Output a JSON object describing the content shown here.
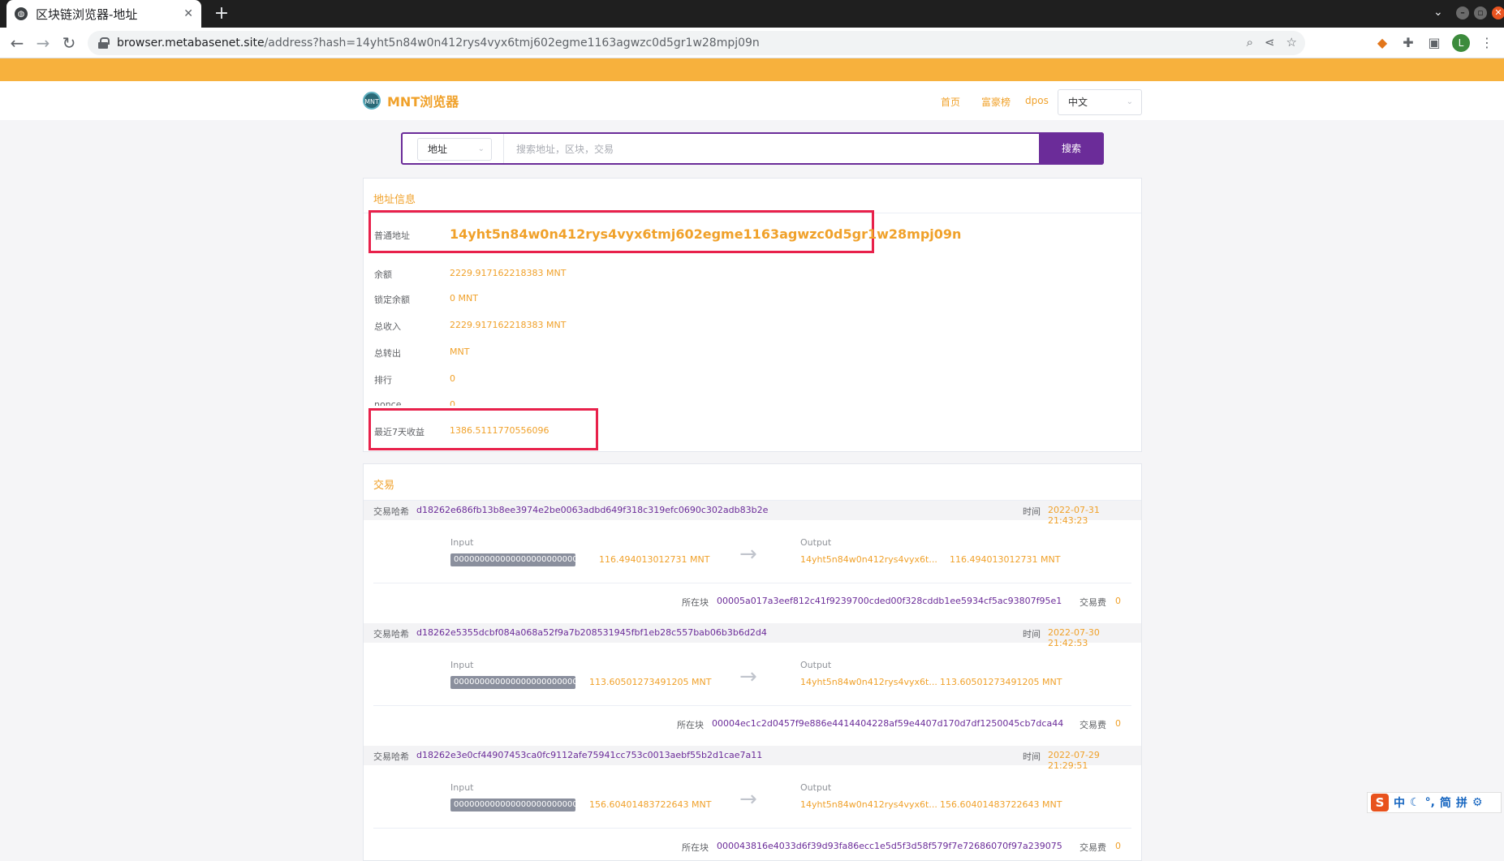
{
  "browser": {
    "tab_title": "区块链浏览器-地址",
    "url_host": "browser.metabasenet.site",
    "url_path": "/address?hash=14yht5n84w0n412rys4vyx6tmj602egme1163agwzc0d5gr1w28mpj09n",
    "avatar_letter": "L"
  },
  "header": {
    "logo_text": "MNT浏览器",
    "nav": [
      "首页",
      "富豪榜",
      "dpos"
    ],
    "language": "中文"
  },
  "search": {
    "type": "地址",
    "placeholder": "搜索地址，区块，交易",
    "button": "搜索"
  },
  "address_info": {
    "title": "地址信息",
    "rows": [
      {
        "label": "普通地址",
        "value": "14yht5n84w0n412rys4vyx6tmj602egme1163agwzc0d5gr1w28mpj09n"
      },
      {
        "label": "余额",
        "value": "2229.917162218383 MNT"
      },
      {
        "label": "锁定余额",
        "value": "0 MNT"
      },
      {
        "label": "总收入",
        "value": "2229.917162218383 MNT"
      },
      {
        "label": "总转出",
        "value": "MNT"
      },
      {
        "label": "排行",
        "value": "0"
      },
      {
        "label": "nonce",
        "value": "0"
      },
      {
        "label": "最近7天收益",
        "value": "1386.5111770556096"
      }
    ]
  },
  "transactions": {
    "title": "交易",
    "hash_label": "交易哈希",
    "time_label": "时间",
    "input_label": "Input",
    "output_label": "Output",
    "block_label": "所在块",
    "fee_label": "交易费",
    "items": [
      {
        "hash": "d18262e686fb13b8ee3974e2be0063adbd649f318c319efc0690c302adb83b2e",
        "time": "2022-07-31 21:43:23",
        "input_addr": "00000000000000000000000000000",
        "input_amount": "116.494013012731 MNT",
        "output_addr": "14yht5n84w0n412rys4vyx6t...",
        "output_amount": "116.494013012731 MNT",
        "block": "00005a017a3eef812c41f9239700cded00f328cddb1ee5934cf5ac93807f95e1",
        "fee": "0"
      },
      {
        "hash": "d18262e5355dcbf084a068a52f9a7b208531945fbf1eb28c557bab06b3b6d2d4",
        "time": "2022-07-30 21:42:53",
        "input_addr": "00000000000000000000000000000",
        "input_amount": "113.60501273491205 MNT",
        "output_addr": "14yht5n84w0n412rys4vyx6t...",
        "output_amount": "113.60501273491205 MNT",
        "block": "00004ec1c2d0457f9e886e4414404228af59e4407d170d7df1250045cb7dca44",
        "fee": "0"
      },
      {
        "hash": "d18262e3e0cf44907453ca0fc9112afe75941cc753c0013aebf55b2d1cae7a11",
        "time": "2022-07-29 21:29:51",
        "input_addr": "00000000000000000000000000000",
        "input_amount": "156.60401483722643 MNT",
        "output_addr": "14yht5n84w0n412rys4vyx6t...",
        "output_amount": "156.60401483722643 MNT",
        "block": "000043816e4033d6f39d93fa86ecc1e5d5f3d58f579f7e72686070f97a239075",
        "fee": "0"
      }
    ]
  },
  "ime": [
    "中",
    "简",
    "拼"
  ]
}
